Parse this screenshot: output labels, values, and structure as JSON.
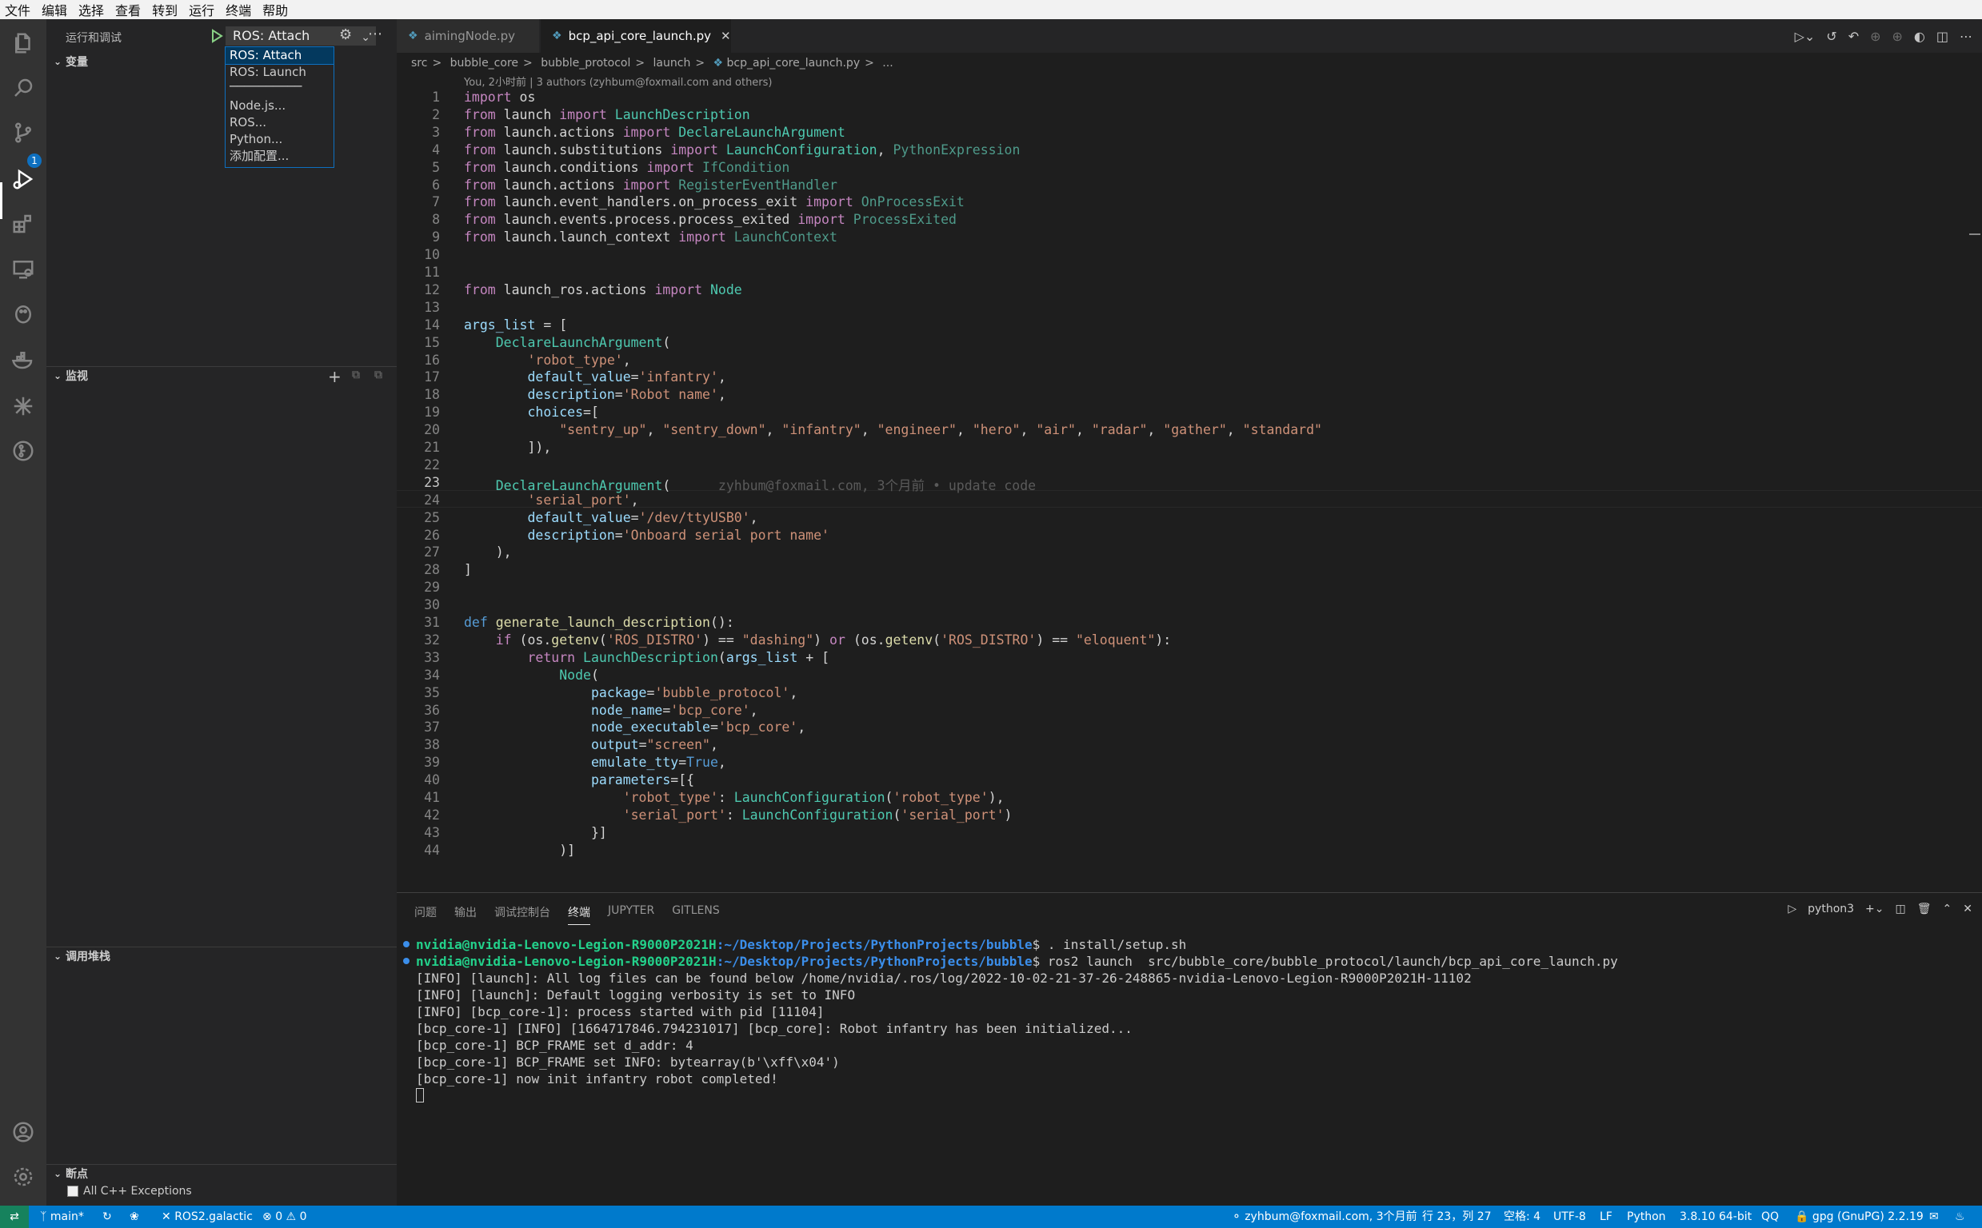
{
  "menubar": [
    "文件",
    "编辑",
    "选择",
    "查看",
    "转到",
    "运行",
    "终端",
    "帮助"
  ],
  "sidebar": {
    "title": "运行和调试",
    "config_selected": "ROS: Attach",
    "dropdown": [
      "ROS: Attach",
      "ROS: Launch",
      "──────────",
      "Node.js...",
      "ROS...",
      "Python...",
      "添加配置..."
    ],
    "sections": {
      "variables": "变量",
      "watch": "监视",
      "callstack": "调用堆栈",
      "breakpoints": "断点"
    },
    "breakpoint_item": "All C++ Exceptions",
    "scm_badge": "1"
  },
  "tabs": [
    {
      "label": "aimingNode.py",
      "active": false
    },
    {
      "label": "bcp_api_core_launch.py",
      "active": true
    }
  ],
  "breadcrumb": [
    "src",
    "bubble_core",
    "bubble_protocol",
    "launch",
    "bcp_api_core_launch.py",
    "..."
  ],
  "codelens": "You, 2小时前 | 3 authors (zyhbum@foxmail.com and others)",
  "blame_inline": "zyhbum@foxmail.com, 3个月前 • update code",
  "code_lines": [
    "import os",
    "from launch import LaunchDescription",
    "from launch.actions import DeclareLaunchArgument",
    "from launch.substitutions import LaunchConfiguration, PythonExpression",
    "from launch.conditions import IfCondition",
    "from launch.actions import RegisterEventHandler",
    "from launch.event_handlers.on_process_exit import OnProcessExit",
    "from launch.events.process.process_exited import ProcessExited",
    "from launch.launch_context import LaunchContext",
    "",
    "",
    "from launch_ros.actions import Node",
    "",
    "args_list = [",
    "    DeclareLaunchArgument(",
    "        'robot_type',",
    "        default_value='infantry',",
    "        description='Robot name',",
    "        choices=[",
    "            \"sentry_up\", \"sentry_down\", \"infantry\", \"engineer\", \"hero\", \"air\", \"radar\", \"gather\", \"standard\"",
    "        ]),",
    "",
    "    DeclareLaunchArgument(",
    "        'serial_port',",
    "        default_value='/dev/ttyUSB0',",
    "        description='Onboard serial port name'",
    "    ),",
    "]",
    "",
    "",
    "def generate_launch_description():",
    "    if (os.getenv('ROS_DISTRO') == \"dashing\") or (os.getenv('ROS_DISTRO') == \"eloquent\"):",
    "        return LaunchDescription(args_list + [",
    "            Node(",
    "                package='bubble_protocol',",
    "                node_name='bcp_core',",
    "                node_executable='bcp_core',",
    "                output=\"screen\",",
    "                emulate_tty=True,",
    "                parameters=[{",
    "                    'robot_type': LaunchConfiguration('robot_type'),",
    "                    'serial_port': LaunchConfiguration('serial_port')",
    "                }]",
    "            )]"
  ],
  "current_line": 23,
  "panel": {
    "tabs": [
      "问题",
      "输出",
      "调试控制台",
      "终端",
      "JUPYTER",
      "GITLENS"
    ],
    "active_tab": "终端",
    "terminal_name": "python3",
    "prompt_user": "nvidia@nvidia-Lenovo-Legion-R9000P2021H",
    "prompt_path": ":~/Desktop/Projects/PythonProjects/bubble",
    "cmd1": "$ . install/setup.sh",
    "cmd2": "$ ros2 launch  src/bubble_core/bubble_protocol/launch/bcp_api_core_launch.py",
    "output": [
      "[INFO] [launch]: All log files can be found below /home/nvidia/.ros/log/2022-10-02-21-37-26-248865-nvidia-Lenovo-Legion-R9000P2021H-11102",
      "[INFO] [launch]: Default logging verbosity is set to INFO",
      "[INFO] [bcp_core-1]: process started with pid [11104]",
      "[bcp_core-1] [INFO] [1664717846.794231017] [bcp_core]: Robot infantry has been initialized...",
      "[bcp_core-1] BCP_FRAME set d_addr: 4",
      "[bcp_core-1] BCP_FRAME set INFO: bytearray(b'\\xff\\x04')",
      "[bcp_core-1] now init infantry robot completed!"
    ]
  },
  "statusbar": {
    "branch": "main*",
    "ros": "ROS2.galactic",
    "errors": "0",
    "warnings": "0",
    "blame": "zyhbum@foxmail.com, 3个月前",
    "position": "行 23，列 27",
    "spaces": "空格: 4",
    "encoding": "UTF-8",
    "eol": "LF",
    "language": "Python",
    "interpreter": "3.8.10 64-bit",
    "qq": "QQ",
    "gpg": "gpg (GnuPG) 2.2.19"
  }
}
